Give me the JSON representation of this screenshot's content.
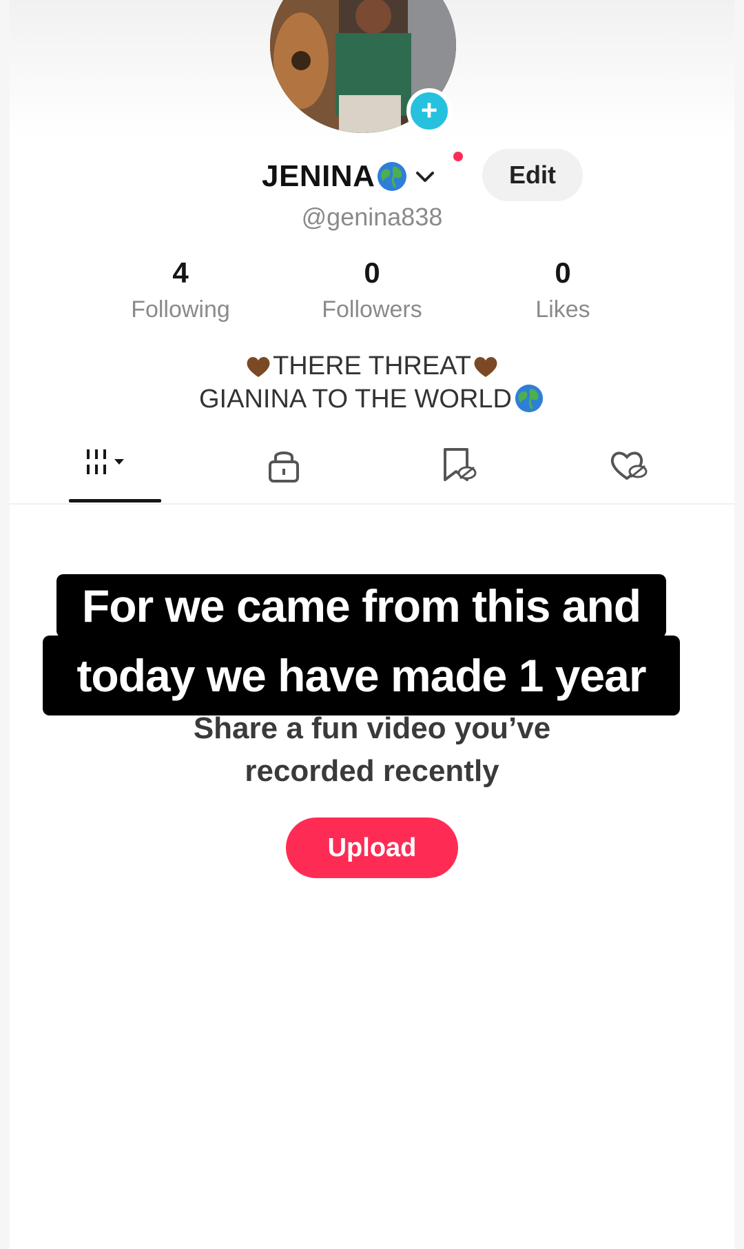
{
  "profile": {
    "display_name": "JENINA",
    "handle": "@genina838",
    "edit_label": "Edit",
    "add_label": "+"
  },
  "stats": [
    {
      "value": "4",
      "label": "Following"
    },
    {
      "value": "0",
      "label": "Followers"
    },
    {
      "value": "0",
      "label": "Likes"
    }
  ],
  "bio": {
    "line1": "THERE THREAT",
    "line2": "GIANINA TO THE WORLD"
  },
  "tabs": [
    {
      "icon": "videos-grid-icon"
    },
    {
      "icon": "lock-icon"
    },
    {
      "icon": "bookmark-icon"
    },
    {
      "icon": "liked-heart-icon"
    }
  ],
  "overlay_caption": {
    "line1": "For we came from this and",
    "line2": "today we have made 1 year"
  },
  "empty_state": {
    "line1": "Share a fun video you’ve",
    "line2": "recorded recently",
    "upload_label": "Upload"
  },
  "colors": {
    "accent_red": "#fe2c55",
    "add_blue": "#25c1de",
    "heart_brown": "#7b4a24"
  }
}
